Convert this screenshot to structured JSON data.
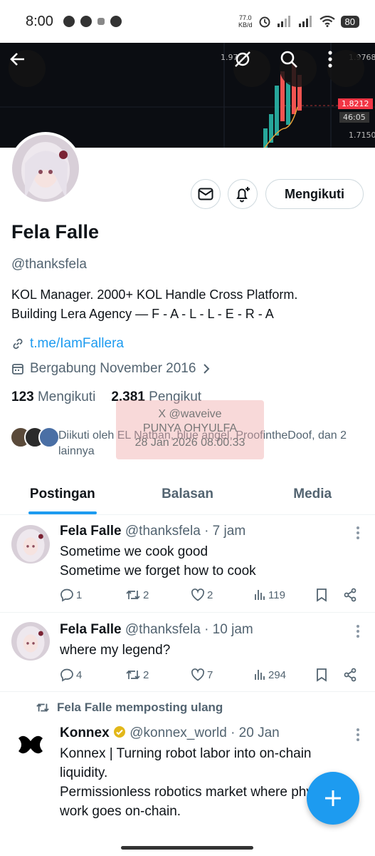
{
  "status_bar": {
    "time": "8:00",
    "net_speed_value": "77.0",
    "net_speed_unit": "KB/d",
    "battery": "80"
  },
  "banner": {
    "price_levels": [
      "1.9768",
      "1.9768",
      "1.8212",
      "46:05",
      "1.7150"
    ],
    "candle_colors": {
      "up": "#26a69a",
      "down": "#ef5350",
      "tag": "#f23645"
    }
  },
  "profile": {
    "name": "Fela Falle",
    "handle": "@thanksfela",
    "bio": "KOL Manager. 2000+ KOL Handle Cross Platform.\nBuilding Lera Agency — F - A - L - L - E - R - A",
    "link": "t.me/IamFallera",
    "joined": "Bergabung November 2016",
    "following_count": "123",
    "following_label": "Mengikuti",
    "followers_count": "2.381",
    "followers_label": "Pengikut",
    "followed_by": "Diikuti oleh EL Nathan, blue angel, ProofintheDoof, dan 2 lainnya",
    "follow_button": "Mengikuti"
  },
  "watermark": {
    "line1": "X @waveive",
    "line2": "PUNYA OHYULFA",
    "line3": "28 Jan 2026 08.00.33"
  },
  "tabs": [
    {
      "label": "Postingan",
      "active": true
    },
    {
      "label": "Balasan",
      "active": false
    },
    {
      "label": "Media",
      "active": false
    }
  ],
  "posts": [
    {
      "author": "Fela Falle",
      "handle": "@thanksfela",
      "time": "· 7 jam",
      "text": "Sometime we cook good\nSometime we forget how to cook",
      "replies": "1",
      "reposts": "2",
      "likes": "2",
      "views": "119"
    },
    {
      "author": "Fela Falle",
      "handle": "@thanksfela",
      "time": "· 10 jam",
      "text": "where my legend?",
      "replies": "4",
      "reposts": "2",
      "likes": "7",
      "views": "294"
    },
    {
      "repost_label": "Fela Falle memposting ulang",
      "author": "Konnex",
      "handle": "@konnex_world",
      "time": "· 20 Jan",
      "text": "Konnex | Turning robot labor into on-chain liquidity.\nPermissionless robotics market where physical work goes on-chain."
    }
  ],
  "colors": {
    "accent": "#1d9bf0",
    "verified": "#e2b719"
  }
}
